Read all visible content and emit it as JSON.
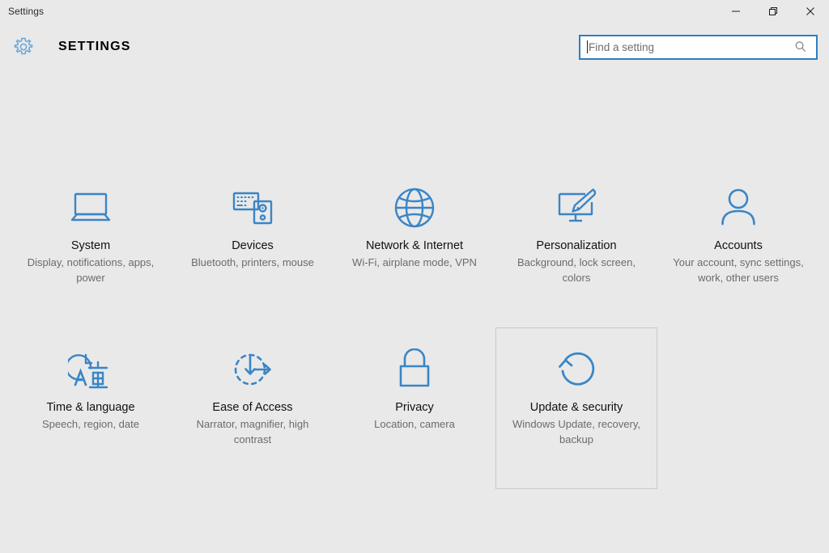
{
  "window": {
    "title": "Settings",
    "controls": {
      "minimize": "Minimize",
      "restore": "Restore",
      "close": "Close"
    }
  },
  "header": {
    "gear_icon": "gear-icon",
    "app_title": "SETTINGS"
  },
  "search": {
    "placeholder": "Find a setting",
    "value": "",
    "icon": "search-icon"
  },
  "colors": {
    "accent_blue": "#2f7ec1",
    "icon_blue": "#3a85c6",
    "page_background": "#e9e9e9",
    "tile_border": "#c9c9c9",
    "title_text": "#111111",
    "subtitle_text": "#6b6b6b"
  },
  "tiles": [
    {
      "id": "system",
      "icon": "laptop-icon",
      "title": "System",
      "subtitle": "Display, notifications, apps, power",
      "selected": false
    },
    {
      "id": "devices",
      "icon": "keyboard-device-icon",
      "title": "Devices",
      "subtitle": "Bluetooth, printers, mouse",
      "selected": false
    },
    {
      "id": "network-internet",
      "icon": "globe-icon",
      "title": "Network & Internet",
      "subtitle": "Wi-Fi, airplane mode, VPN",
      "selected": false
    },
    {
      "id": "personalization",
      "icon": "monitor-brush-icon",
      "title": "Personalization",
      "subtitle": "Background, lock screen, colors",
      "selected": false
    },
    {
      "id": "accounts",
      "icon": "person-icon",
      "title": "Accounts",
      "subtitle": "Your account, sync settings, work, other users",
      "selected": false
    },
    {
      "id": "time-language",
      "icon": "clock-language-icon",
      "title": "Time & language",
      "subtitle": "Speech, region, date",
      "selected": false
    },
    {
      "id": "ease-of-access",
      "icon": "ease-of-access-icon",
      "title": "Ease of Access",
      "subtitle": "Narrator, magnifier, high contrast",
      "selected": false
    },
    {
      "id": "privacy",
      "icon": "lock-icon",
      "title": "Privacy",
      "subtitle": "Location, camera",
      "selected": false
    },
    {
      "id": "update-security",
      "icon": "refresh-circle-icon",
      "title": "Update & security",
      "subtitle": "Windows Update, recovery, backup",
      "selected": true
    }
  ]
}
